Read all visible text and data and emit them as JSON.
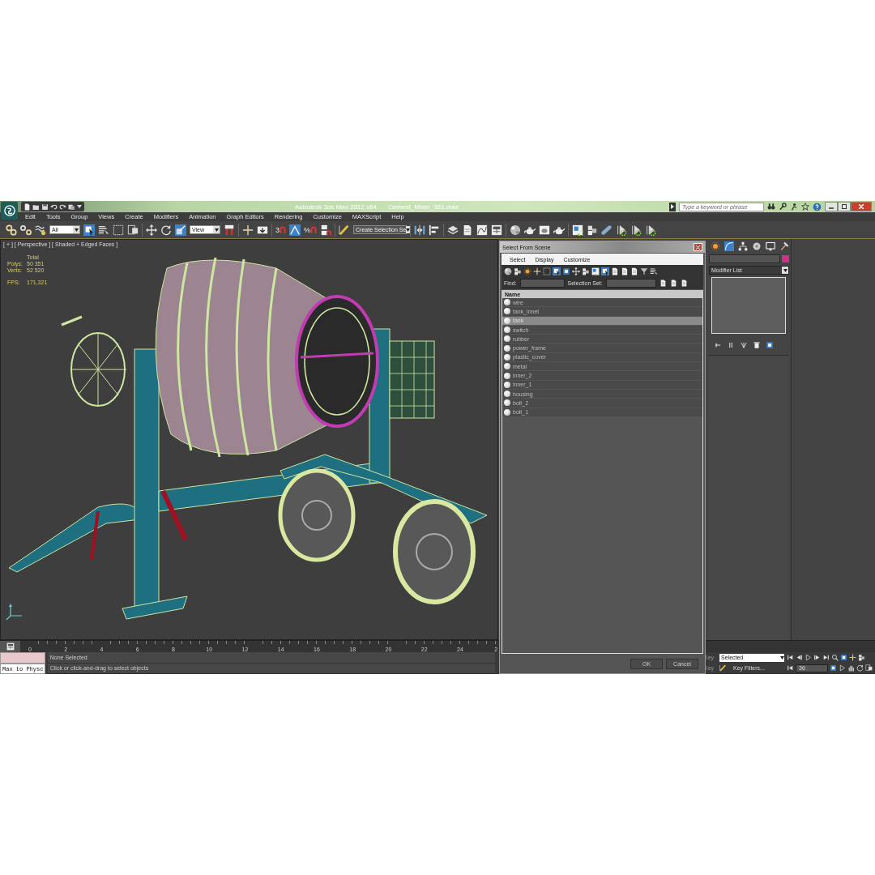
{
  "title_bar": {
    "app": "Autodesk 3ds Max  2012 x64",
    "file": "Cement_Mixer_361.max",
    "search": {
      "placeholder": "Type a keyword or phrase"
    }
  },
  "menu": [
    "Edit",
    "Tools",
    "Group",
    "Views",
    "Create",
    "Modifiers",
    "Animation",
    "Graph Editors",
    "Rendering",
    "Customize",
    "MAXScript",
    "Help"
  ],
  "toolbar": {
    "selection_filter": "All",
    "reference_coordinates": "View",
    "snap_label": "3",
    "percent_snap_label": "%",
    "named_selection": "Create Selection Se"
  },
  "viewport": {
    "label": "[ + ] [ Perspective ] [ Shaded + Edged Faces ]",
    "stats_header": "Total",
    "stats": [
      {
        "label": "Polys:",
        "value": "50 351"
      },
      {
        "label": "Verts:",
        "value": "52 520"
      }
    ],
    "fps": {
      "label": "FPS:",
      "value": "171,321"
    }
  },
  "dialog": {
    "title": "Select From Scene",
    "menu": [
      "Select",
      "Display",
      "Customize"
    ],
    "find_label": "Find:",
    "selection_set_label": "Selection Set:",
    "column": "Name",
    "items": [
      {
        "name": "wire",
        "selected": false
      },
      {
        "name": "tank_innet",
        "selected": false
      },
      {
        "name": "tank",
        "selected": true
      },
      {
        "name": "switch",
        "selected": false
      },
      {
        "name": "rubber",
        "selected": false
      },
      {
        "name": "power_frame",
        "selected": false
      },
      {
        "name": "plastic_cover",
        "selected": false
      },
      {
        "name": "metal",
        "selected": false
      },
      {
        "name": "inner_2",
        "selected": false
      },
      {
        "name": "inner_1",
        "selected": false
      },
      {
        "name": "housing",
        "selected": false
      },
      {
        "name": "bolt_2",
        "selected": false
      },
      {
        "name": "bolt_1",
        "selected": false
      }
    ],
    "buttons": [
      "OK",
      "Cancel"
    ]
  },
  "command_panel": {
    "color": "#d0308c",
    "modifier_list": "Modifier List"
  },
  "timeline": {
    "labels": [
      "0",
      "2",
      "4",
      "6",
      "8",
      "10",
      "12",
      "14",
      "16",
      "18",
      "20",
      "22",
      "24",
      "2"
    ]
  },
  "status_bar": {
    "listener": "Max to Physc",
    "selection": "None Selected",
    "prompt": "Click or click-and-drag to select objects"
  },
  "anim_controls": {
    "auto_key": "Key",
    "set_key": "Key",
    "key_mode": "Selected",
    "key_filters": "Key Filters...",
    "frame": "36"
  }
}
